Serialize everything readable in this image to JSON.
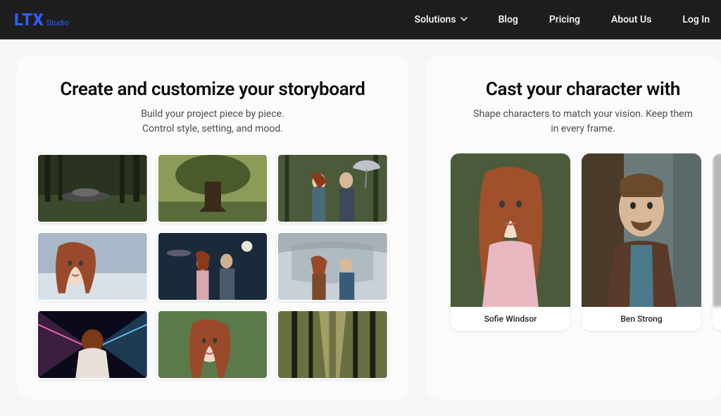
{
  "brand": {
    "main": "LTX",
    "sub": "Studio"
  },
  "nav": {
    "solutions": "Solutions",
    "blog": "Blog",
    "pricing": "Pricing",
    "about": "About Us",
    "login": "Log In"
  },
  "left": {
    "title": "Create and customize your storyboard",
    "sub1": "Build your project piece by piece.",
    "sub2": "Control style, setting, and mood."
  },
  "right": {
    "title": "Cast your character with",
    "sub1": "Shape characters to match your vision. Keep them",
    "sub2": "in every frame."
  },
  "cast": {
    "c1": "Sofie Windsor",
    "c2": "Ben Strong"
  }
}
